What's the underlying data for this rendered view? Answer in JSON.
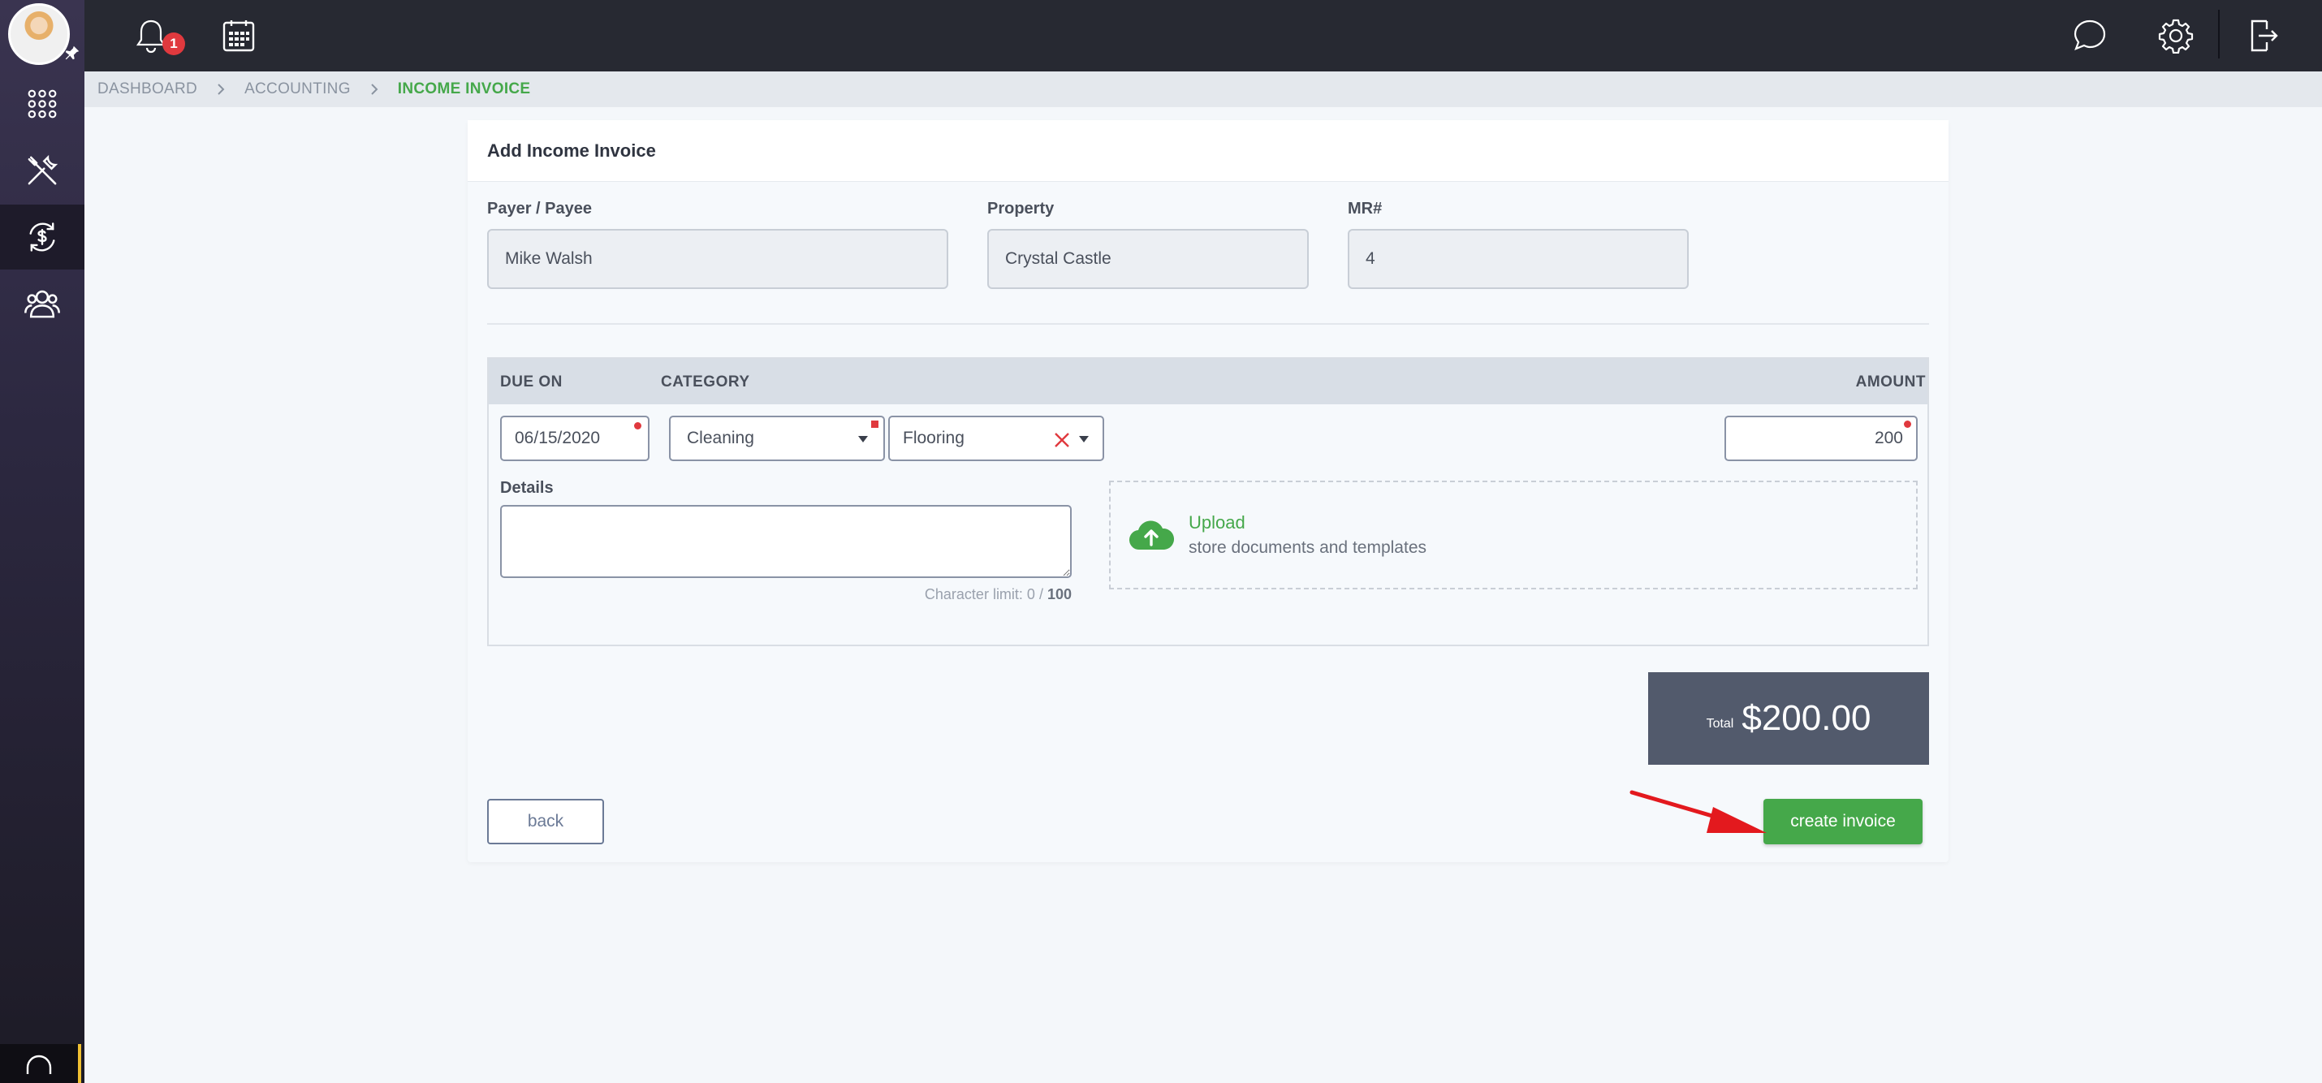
{
  "breadcrumb": {
    "items": [
      "DASHBOARD",
      "ACCOUNTING",
      "INCOME INVOICE"
    ]
  },
  "topbar": {
    "notification_count": "1",
    "icons": [
      "bell-icon",
      "calendar-icon",
      "chat-icon",
      "gear-icon",
      "logout-icon"
    ]
  },
  "sidebar": {
    "items": [
      "apps-grid-icon",
      "tools-icon",
      "accounting-icon",
      "users-icon"
    ],
    "active": "accounting-icon",
    "footer_icon": "headset-icon"
  },
  "form": {
    "title": "Add Income Invoice",
    "payer_label": "Payer / Payee",
    "payer_value": "Mike Walsh",
    "property_label": "Property",
    "property_value": "Crystal Castle",
    "mr_label": "MR#",
    "mr_value": "4"
  },
  "table": {
    "headers": {
      "due_on": "DUE ON",
      "category": "CATEGORY",
      "amount": "AMOUNT"
    },
    "row": {
      "due_date": "06/15/2020",
      "category": "Cleaning",
      "subcategory": "Flooring",
      "amount": "200"
    },
    "details_label": "Details",
    "details_value": "",
    "char_limit_prefix": "Character limit: 0 / ",
    "char_limit_max": "100",
    "upload_title": "Upload",
    "upload_subtitle": "store documents and templates"
  },
  "total": {
    "label": "Total",
    "value": "$200.00"
  },
  "actions": {
    "back_label": "back",
    "create_label": "create invoice"
  },
  "colors": {
    "accent": "#45a84a",
    "topbar": "#272932",
    "required": "#e0393e",
    "total_bg": "#525a6c",
    "annotation_arrow": "#e3191e"
  }
}
